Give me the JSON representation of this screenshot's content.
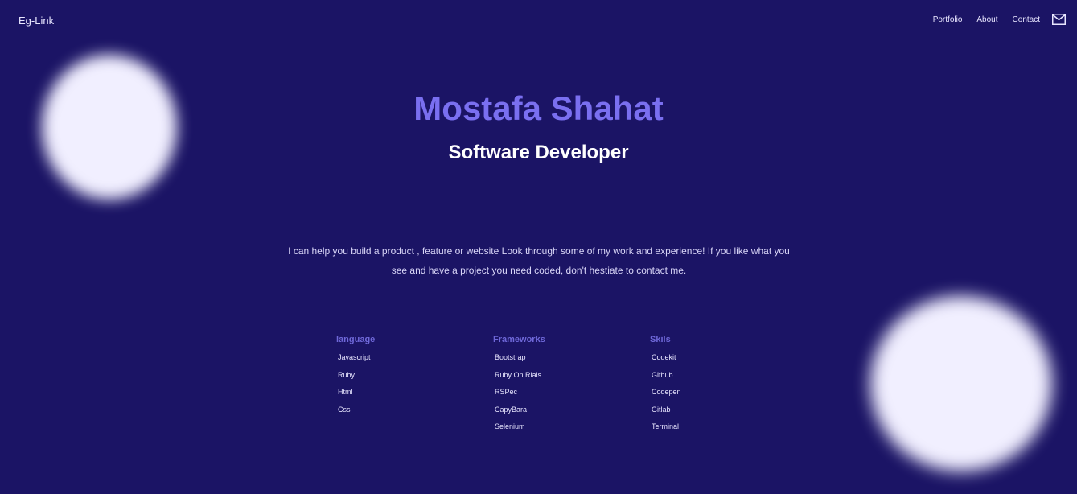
{
  "header": {
    "brand": "Eg-Link",
    "nav": [
      {
        "label": "Portfolio"
      },
      {
        "label": "About"
      },
      {
        "label": "Contact"
      }
    ],
    "mail_icon": "mail-icon"
  },
  "hero": {
    "name": "Mostafa Shahat",
    "role": "Software Developer"
  },
  "intro": {
    "line1": "I can help you build a product , feature or website Look through some of my work and experience! If you like what you",
    "line2": "see and have a project you need coded, don't hestiate to contact me."
  },
  "skills": {
    "columns": [
      {
        "title": "language",
        "items": [
          "Javascript",
          "Ruby",
          "Html",
          "Css"
        ]
      },
      {
        "title": "Frameworks",
        "items": [
          "Bootstrap",
          "Ruby On Rials",
          "RSPec",
          "CapyBara",
          "Selenium"
        ]
      },
      {
        "title": "Skils",
        "items": [
          "Codekit",
          "Github",
          "Codepen",
          "Gitlab",
          "Terminal"
        ]
      }
    ]
  },
  "colors": {
    "background": "#1b1465",
    "accent": "#7a6ff0",
    "orb": "#f1efff"
  }
}
